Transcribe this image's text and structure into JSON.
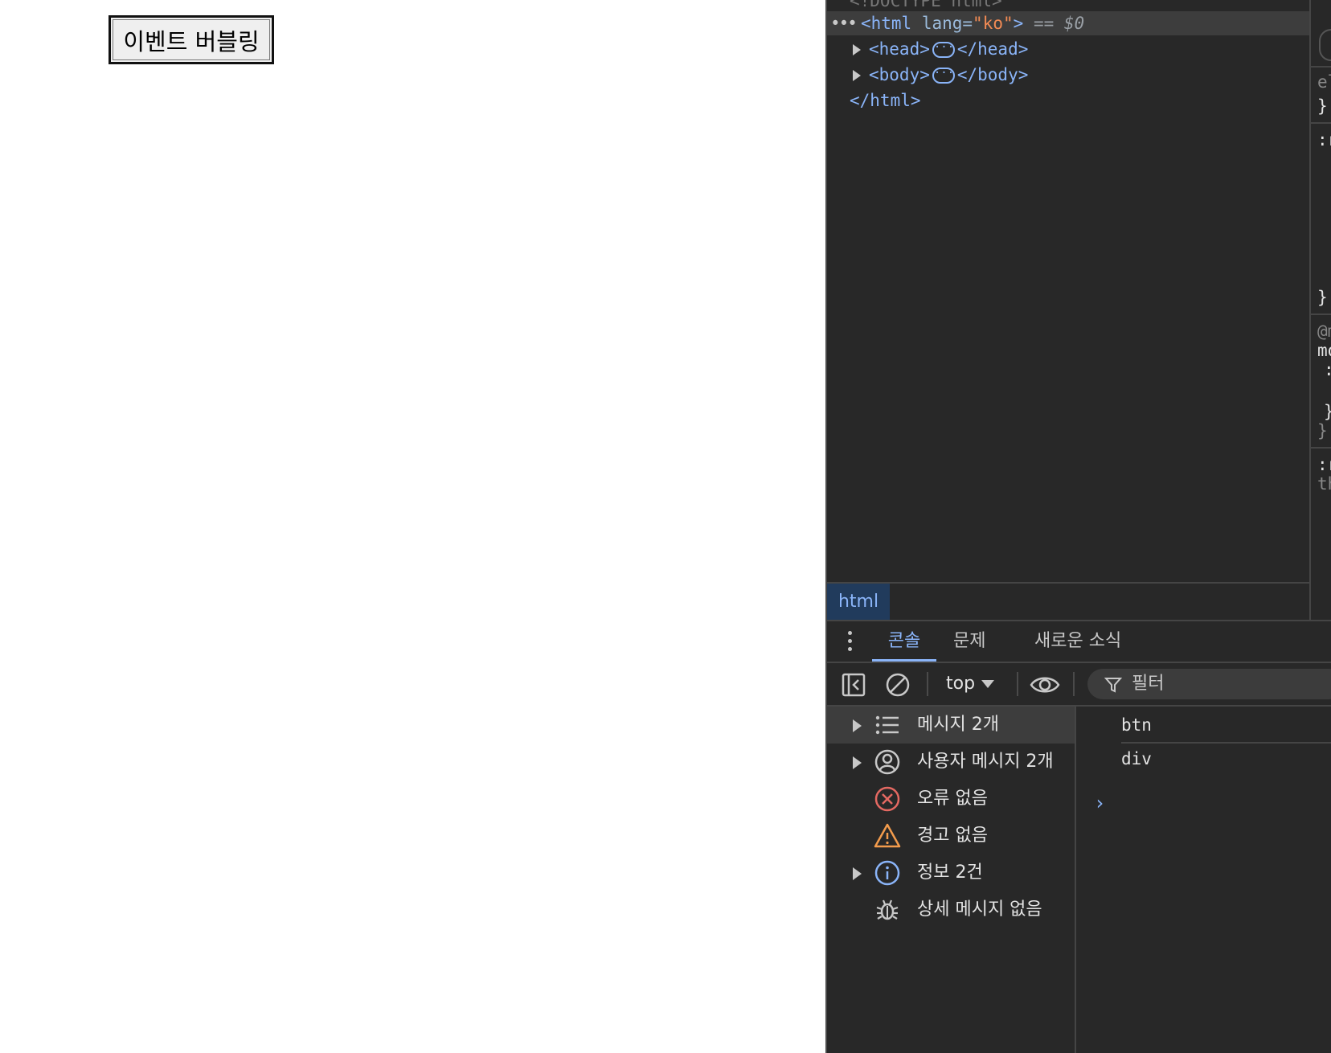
{
  "page": {
    "button_label": "이벤트 버블링"
  },
  "elements_panel": {
    "doctype_partial": "<!DOCTYPE html>",
    "selected_line": {
      "open_tag": "<html",
      "attr_name": "lang",
      "attr_value": "\"ko\"",
      "close_bracket": ">",
      "selection_marker": "== $0"
    },
    "head_open": "<head>",
    "head_close": "</head>",
    "body_open": "<body>",
    "body_close": "</body>",
    "html_close": "</html>",
    "breadcrumb": "html",
    "styles_fragments": [
      "el",
      "}",
      ":r",
      "}",
      "@m",
      "mo",
      ":",
      "}",
      "}",
      ":r",
      "th"
    ]
  },
  "drawer": {
    "tabs": [
      {
        "label": "콘솔",
        "active": true
      },
      {
        "label": "문제",
        "active": false
      },
      {
        "label": "새로운 소식",
        "active": false
      }
    ]
  },
  "console_toolbar": {
    "context": "top",
    "filter_placeholder": "필터"
  },
  "console_sidebar": {
    "items": [
      {
        "label": "메시지 2개",
        "icon": "list-icon",
        "expandable": true,
        "selected": true
      },
      {
        "label": "사용자 메시지 2개",
        "icon": "user-circle-icon",
        "expandable": true,
        "selected": false
      },
      {
        "label": "오류 없음",
        "icon": "error-icon",
        "expandable": false,
        "selected": false
      },
      {
        "label": "경고 없음",
        "icon": "warning-icon",
        "expandable": false,
        "selected": false
      },
      {
        "label": "정보 2건",
        "icon": "info-icon",
        "expandable": true,
        "selected": false
      },
      {
        "label": "상세 메시지 없음",
        "icon": "bug-icon",
        "expandable": false,
        "selected": false
      }
    ]
  },
  "console_output": {
    "lines": [
      "btn",
      "div"
    ],
    "prompt": "›"
  },
  "colors": {
    "devtools_bg": "#282828",
    "accent": "#8ab4f8",
    "error": "#e46962",
    "warning": "#f29b4c"
  }
}
